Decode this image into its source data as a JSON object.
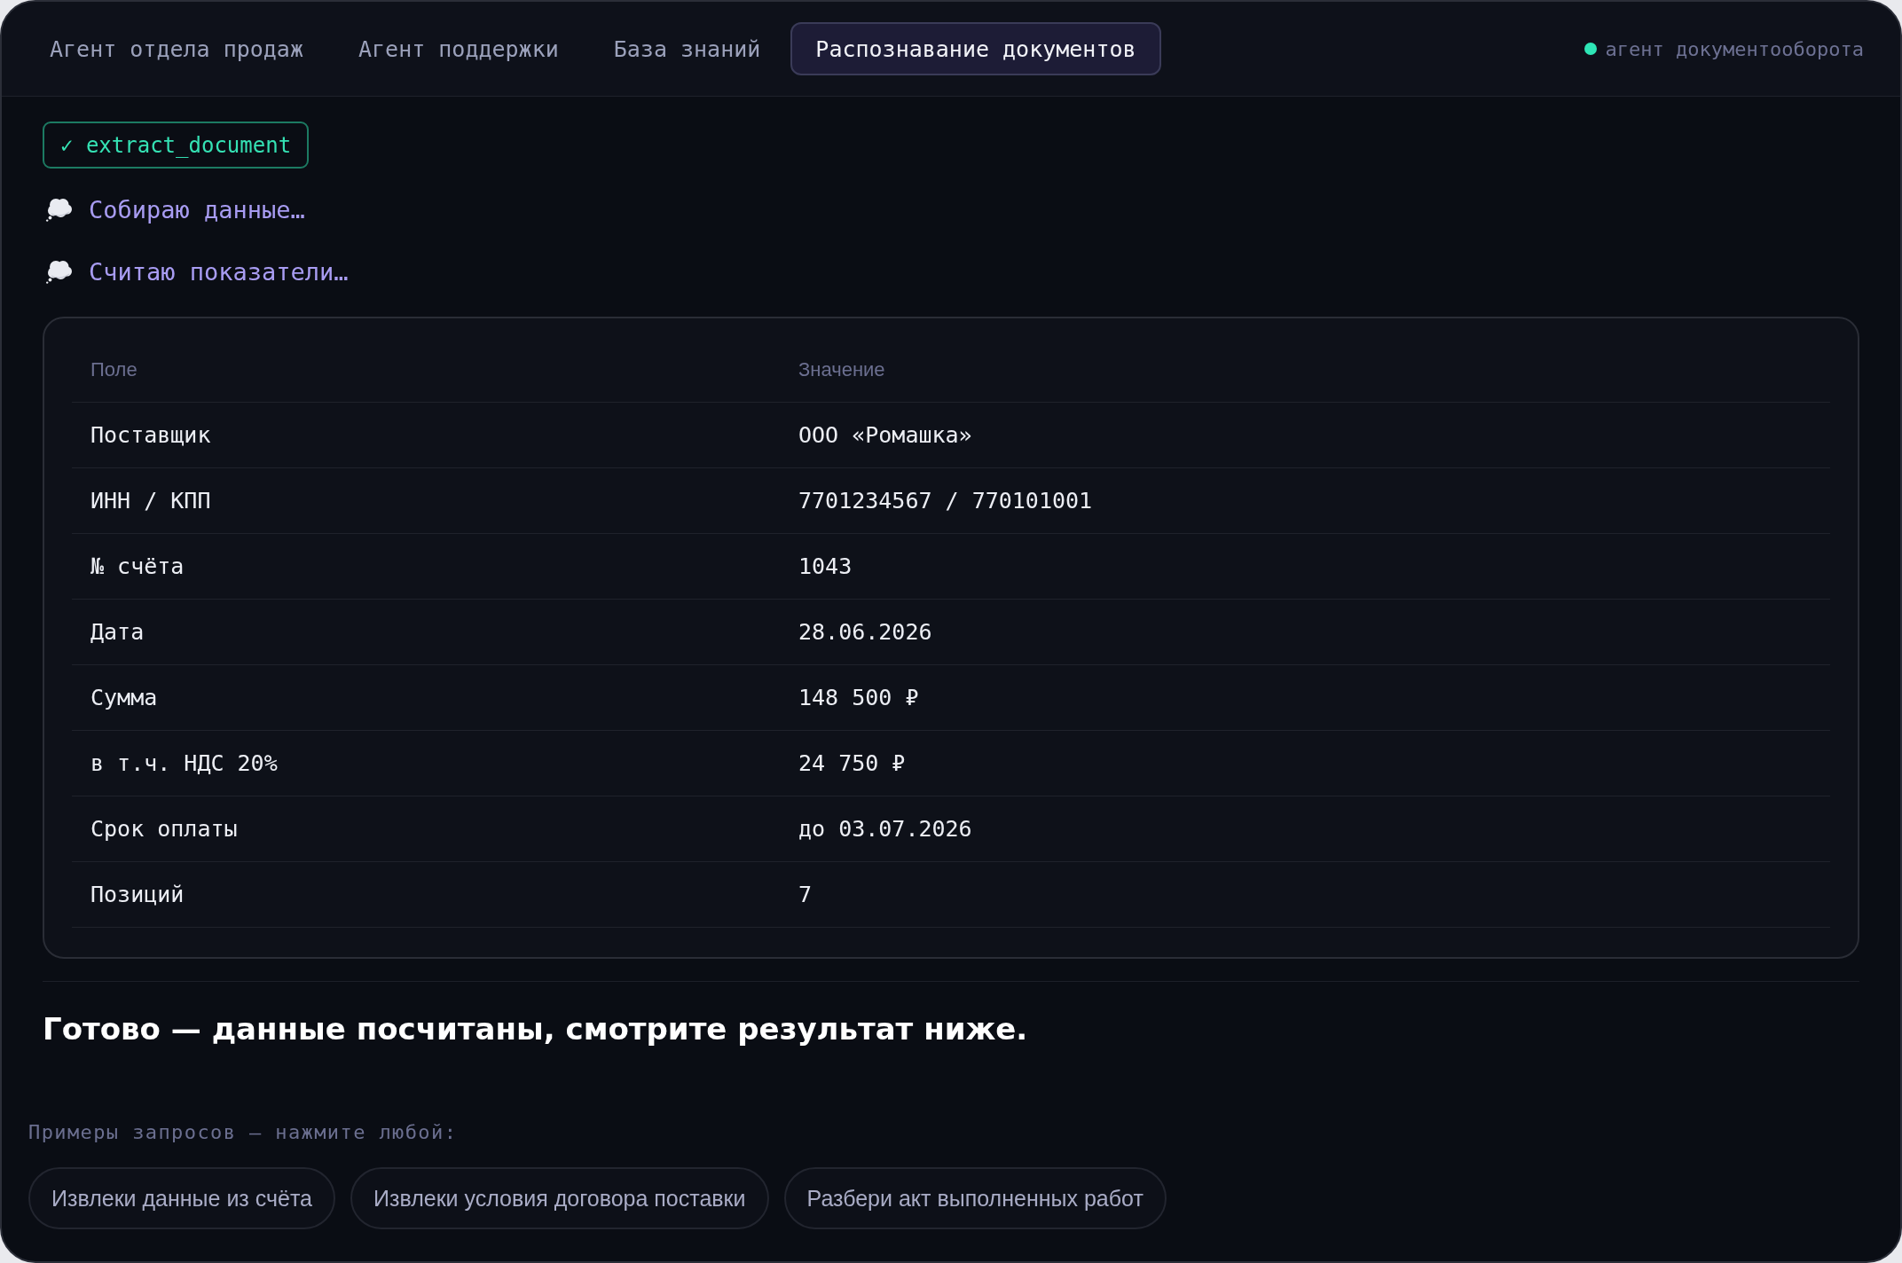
{
  "tabs": [
    {
      "label": "Агент отдела продаж",
      "selected": false
    },
    {
      "label": "Агент поддержки",
      "selected": false
    },
    {
      "label": "База знаний",
      "selected": false
    },
    {
      "label": "Распознавание документов",
      "selected": true
    }
  ],
  "status": {
    "label": "агент документооборота",
    "online": true
  },
  "tool_call": {
    "label": "✓ extract_document"
  },
  "thoughts": [
    "Собираю данные…",
    "Считаю показатели…"
  ],
  "table": {
    "columns": [
      "Поле",
      "Значение"
    ],
    "rows": [
      [
        "Поставщик",
        "ООО «Ромашка»"
      ],
      [
        "ИНН / КПП",
        "7701234567 / 770101001"
      ],
      [
        "№ счёта",
        "1043"
      ],
      [
        "Дата",
        "28.06.2026"
      ],
      [
        "Сумма",
        "148 500 ₽"
      ],
      [
        "в т.ч. НДС 20%",
        "24 750 ₽"
      ],
      [
        "Срок оплаты",
        "до 03.07.2026"
      ],
      [
        "Позиций",
        "7"
      ]
    ]
  },
  "answer": "Готово — данные посчитаны, смотрите результат ниже.",
  "examples": {
    "label": "Примеры запросов — нажмите любой:",
    "chips": [
      "Извлеки данные из счёта",
      "Извлеки условия договора поставки",
      "Разбери акт выполненных работ"
    ]
  }
}
